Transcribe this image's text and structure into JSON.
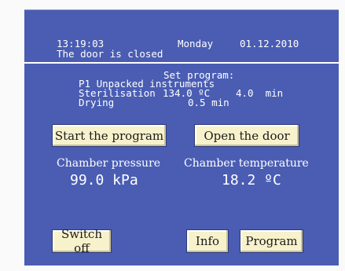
{
  "header": {
    "time": "13:19:03",
    "day": "Monday",
    "date": "01.12.2010",
    "status": "The door is closed"
  },
  "program": {
    "title": "Set program:",
    "name": "P1 Unpacked instruments",
    "sterilisation_label": "Sterilisation",
    "sterilisation_temp": "134.0 ºC",
    "sterilisation_time": "4.0  min",
    "drying_label": "Drying",
    "drying_time": "0.5 min"
  },
  "buttons": {
    "start": "Start the program",
    "open_door": "Open the door",
    "switch_off": "Switch off",
    "info": "Info",
    "program": "Program"
  },
  "readouts": {
    "pressure_label": "Chamber pressure",
    "pressure_value": "99.0 kPa",
    "temperature_label": "Chamber temperature",
    "temperature_value": "18.2 ºC"
  },
  "colors": {
    "panel": "#4a5db3",
    "button": "#f7f2cc",
    "text": "#ffffff"
  }
}
